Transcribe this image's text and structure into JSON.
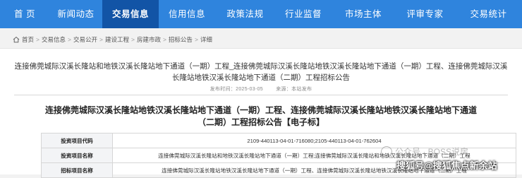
{
  "nav": {
    "items": [
      {
        "label": "首 页"
      },
      {
        "label": "新闻动态"
      },
      {
        "label": "交易信息"
      },
      {
        "label": "信用信息"
      },
      {
        "label": "政策法规"
      },
      {
        "label": "行业监督"
      },
      {
        "label": "市场主体"
      },
      {
        "label": "评审专家"
      },
      {
        "label": "交易统计"
      }
    ],
    "active": "交易信息",
    "color": "#2f84dd",
    "active_color": "#1254a6"
  },
  "breadcrumb": {
    "items": [
      "首页",
      "交易信息",
      "交易公开",
      "建设工程",
      "房建市政",
      "招标公告",
      "详细"
    ],
    "separator": ">"
  },
  "notice": {
    "title": "连接佛莞城际汉溪长隆站和地铁汉溪长隆站地下通道（一期）工程_连接佛莞城际汉溪长隆站地铁汉溪长隆站地下通道（一期）工程、连接佛莞城际汉溪长隆站地铁汉溪长隆站地下通道（二期）工程招标公告",
    "publish_time_label": "发布时间：2025-03-05",
    "source_label": "来源：本站发布"
  },
  "document": {
    "title": "连接佛莞城际汉溪长隆站地铁汉溪长隆站地下通道（一期）工程、连接佛莞城际汉溪长隆站地铁汉溪长隆站地下通道（二期）工程招标公告【电子标】",
    "table": [
      {
        "label": "投资项目代码",
        "value": "2109-440113-04-01-716080;2105-440113-04-01-762604"
      },
      {
        "label": "投资项目名称",
        "value": "连接佛莞城际汉溪长隆站和地铁汉溪长隆站地下通道（一期）工程;连接佛莞城际汉溪长隆站和地铁汉溪长隆站地下通道（二期）工程"
      },
      {
        "label": "招标项目名称",
        "value": "连接佛莞城际汉溪长隆站地铁汉溪长隆站地下通道（一期）工程、连接佛莞城际汉溪长隆站地铁汉溪长隆站地下通道（二期）工程"
      }
    ]
  },
  "watermark": {
    "line1": "公众号 · BOSS说房",
    "line2": "搜狐号@搜狐焦点新余站"
  }
}
